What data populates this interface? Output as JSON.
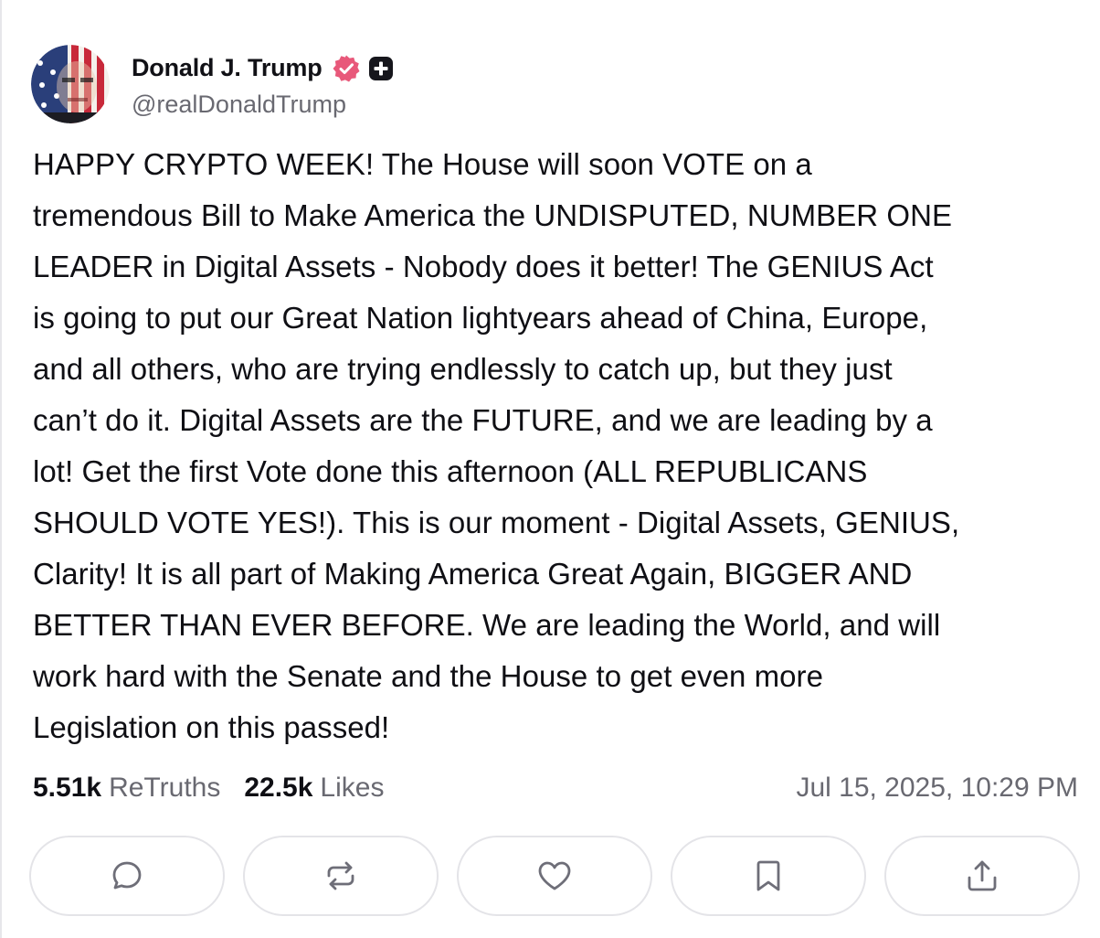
{
  "post": {
    "display_name": "Donald J. Trump",
    "handle": "@realDonaldTrump",
    "text": "HAPPY CRYPTO WEEK! The House will soon VOTE on a\ntremendous Bill to Make America the UNDISPUTED, NUMBER ONE\nLEADER in Digital Assets - Nobody does it better! The GENIUS Act\nis going to put our Great Nation lightyears ahead of China, Europe,\nand all others, who are trying endlessly to catch up, but they just\ncan’t do it. Digital Assets are the FUTURE, and we are leading by a\nlot! Get the first Vote done this afternoon (ALL REPUBLICANS\nSHOULD VOTE YES!). This is our moment - Digital Assets, GENIUS,\nClarity! It is all part of Making America Great Again, BIGGER AND\nBETTER THAN EVER BEFORE. We are leading the World, and will\nwork hard with the Senate and the House to get even more\nLegislation on this passed!",
    "retruths_count": "5.51k",
    "retruths_label": "ReTruths",
    "likes_count": "22.5k",
    "likes_label": "Likes",
    "timestamp": "Jul 15, 2025, 10:29 PM"
  },
  "icons": {
    "verified": "verified-badge-icon",
    "plus": "plus-badge-icon",
    "actions": [
      "reply-icon",
      "retruth-icon",
      "like-icon",
      "bookmark-icon",
      "share-icon"
    ]
  },
  "colors": {
    "verified_badge": "#e8587a",
    "text": "#0f0f14",
    "muted": "#696971",
    "border": "#e4e4e8"
  }
}
